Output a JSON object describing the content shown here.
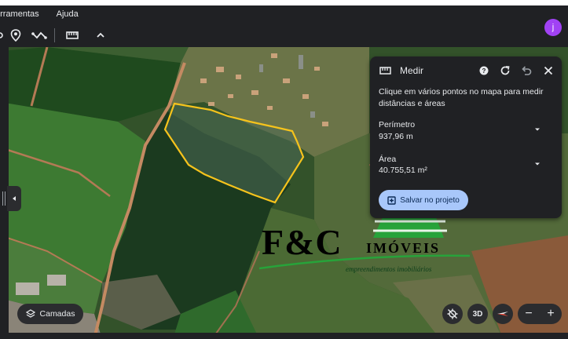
{
  "menu": {
    "items": [
      "erramentas",
      "Ajuda"
    ]
  },
  "toolbar": {
    "icons": [
      "marker-icon",
      "path-icon",
      "ruler-icon",
      "chevron-up-icon"
    ]
  },
  "account": {
    "initial": "j"
  },
  "measure_panel": {
    "title": "Medir",
    "description": "Clique em vários pontos no mapa para medir distâncias e áreas",
    "perimeter_label": "Perímetro",
    "perimeter_value": "937,96 m",
    "area_label": "Área",
    "area_value": "40.755,51 m²",
    "save_label": "Salvar no projeto"
  },
  "controls": {
    "layers_label": "Camadas",
    "view_3d_label": "3D",
    "zoom_out_label": "−",
    "zoom_in_label": "+"
  },
  "watermark": {
    "brand": "F&C",
    "brand_suffix": "IMÓVEIS",
    "tagline": "empreendimentos imobiliários"
  },
  "colors": {
    "ui_dark": "#202124",
    "button_accent": "#a8c7fa",
    "polygon_outline": "#f6c31c",
    "avatar": "#a142f4"
  }
}
